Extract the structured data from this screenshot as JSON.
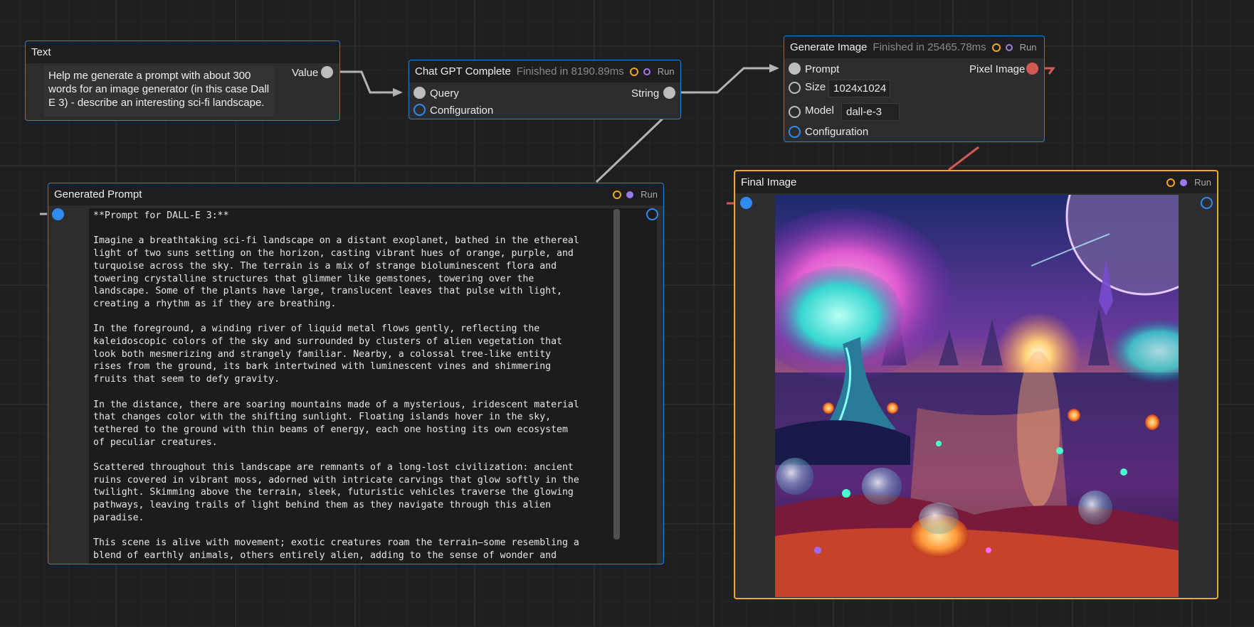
{
  "nodes": {
    "text": {
      "title": "Text",
      "output_label": "Value",
      "value": "Help me generate a prompt with about 300 words for an image generator (in this case Dall E 3) - describe an interesting sci-fi landscape."
    },
    "chat": {
      "title": "Chat GPT Complete",
      "status": "Finished in 8190.89ms",
      "run_label": "Run",
      "inputs": [
        "Query",
        "Configuration"
      ],
      "output_label": "String"
    },
    "generate": {
      "title": "Generate Image",
      "status": "Finished in 25465.78ms",
      "run_label": "Run",
      "prompt_label": "Prompt",
      "size_label": "Size",
      "size_value": "1024x1024",
      "model_label": "Model",
      "model_value": "dall-e-3",
      "config_label": "Configuration",
      "output_label": "Pixel Image"
    },
    "prompt": {
      "title": "Generated Prompt",
      "run_label": "Run",
      "content": "**Prompt for DALL-E 3:**\n\nImagine a breathtaking sci-fi landscape on a distant exoplanet, bathed in the ethereal\nlight of two suns setting on the horizon, casting vibrant hues of orange, purple, and\nturquoise across the sky. The terrain is a mix of strange bioluminescent flora and\ntowering crystalline structures that glimmer like gemstones, towering over the\nlandscape. Some of the plants have large, translucent leaves that pulse with light,\ncreating a rhythm as if they are breathing.\n\nIn the foreground, a winding river of liquid metal flows gently, reflecting the\nkaleidoscopic colors of the sky and surrounded by clusters of alien vegetation that\nlook both mesmerizing and strangely familiar. Nearby, a colossal tree-like entity\nrises from the ground, its bark intertwined with luminescent vines and shimmering\nfruits that seem to defy gravity.\n\nIn the distance, there are soaring mountains made of a mysterious, iridescent material\nthat changes color with the shifting sunlight. Floating islands hover in the sky,\ntethered to the ground with thin beams of energy, each one hosting its own ecosystem\nof peculiar creatures.\n\nScattered throughout this landscape are remnants of a long-lost civilization: ancient\nruins covered in vibrant moss, adorned with intricate carvings that glow softly in the\ntwilight. Skimming above the terrain, sleek, futuristic vehicles traverse the glowing\npathways, leaving trails of light behind them as they navigate through this alien\nparadise.\n\nThis scene is alive with movement; exotic creatures roam the terrain—some resembling a\nblend of earthly animals, others entirely alien, adding to the sense of wonder and"
    },
    "final": {
      "title": "Final Image",
      "run_label": "Run"
    }
  },
  "colors": {
    "canvas": "#1f1f20",
    "node_border": "#2f7fd0",
    "selected_border": "#f1a81d",
    "wire": "#b4b4b4",
    "image_wire": "#d25a55"
  }
}
